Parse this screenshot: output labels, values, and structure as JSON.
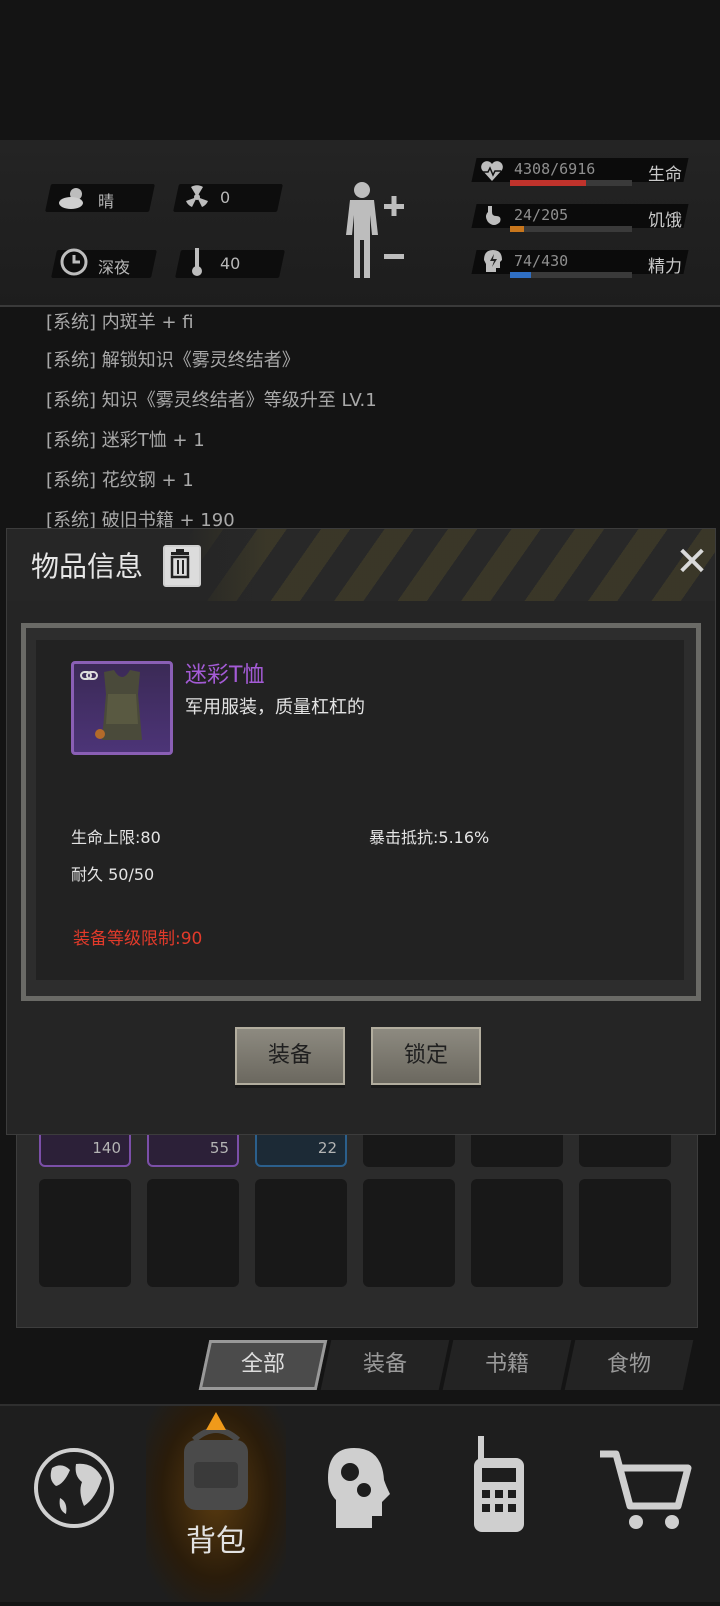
{
  "status": {
    "weather": "晴",
    "radiation": "0",
    "time_of_day": "深夜",
    "temperature": "40",
    "bars": [
      {
        "value": "4308/6916",
        "label": "生命",
        "fraction": 0.623,
        "color": "#c0332c",
        "icon": "heart-pulse-icon"
      },
      {
        "value": "24/205",
        "label": "饥饿",
        "fraction": 0.117,
        "color": "#c8761c",
        "icon": "stomach-icon"
      },
      {
        "value": "74/430",
        "label": "精力",
        "fraction": 0.172,
        "color": "#2f6fc4",
        "icon": "energy-head-icon"
      }
    ]
  },
  "log": {
    "lines": [
      "[系统] 内斑羊 + fi",
      "[系统] 解锁知识《雾灵终结者》",
      "[系统] 知识《雾灵终结者》等级升至 LV.1",
      "[系统] 迷彩T恤 + 1",
      "[系统] 花纹钢 + 1",
      "[系统] 破旧书籍 + 190"
    ]
  },
  "dialog": {
    "title": "物品信息",
    "item_name": "迷彩T恤",
    "item_desc": "军用服装，质量杠杠的",
    "attrs": {
      "hp_max": "生命上限:80",
      "crit_resist": "暴击抵抗:5.16%",
      "durability": "耐久 50/50"
    },
    "requirement": "装备等级限制:90",
    "buttons": {
      "equip": "装备",
      "lock": "锁定"
    }
  },
  "inventory": {
    "counts": [
      "140",
      "55",
      "22"
    ]
  },
  "tabs": [
    "全部",
    "装备",
    "书籍",
    "食物"
  ],
  "nav": {
    "bag_label": "背包"
  }
}
